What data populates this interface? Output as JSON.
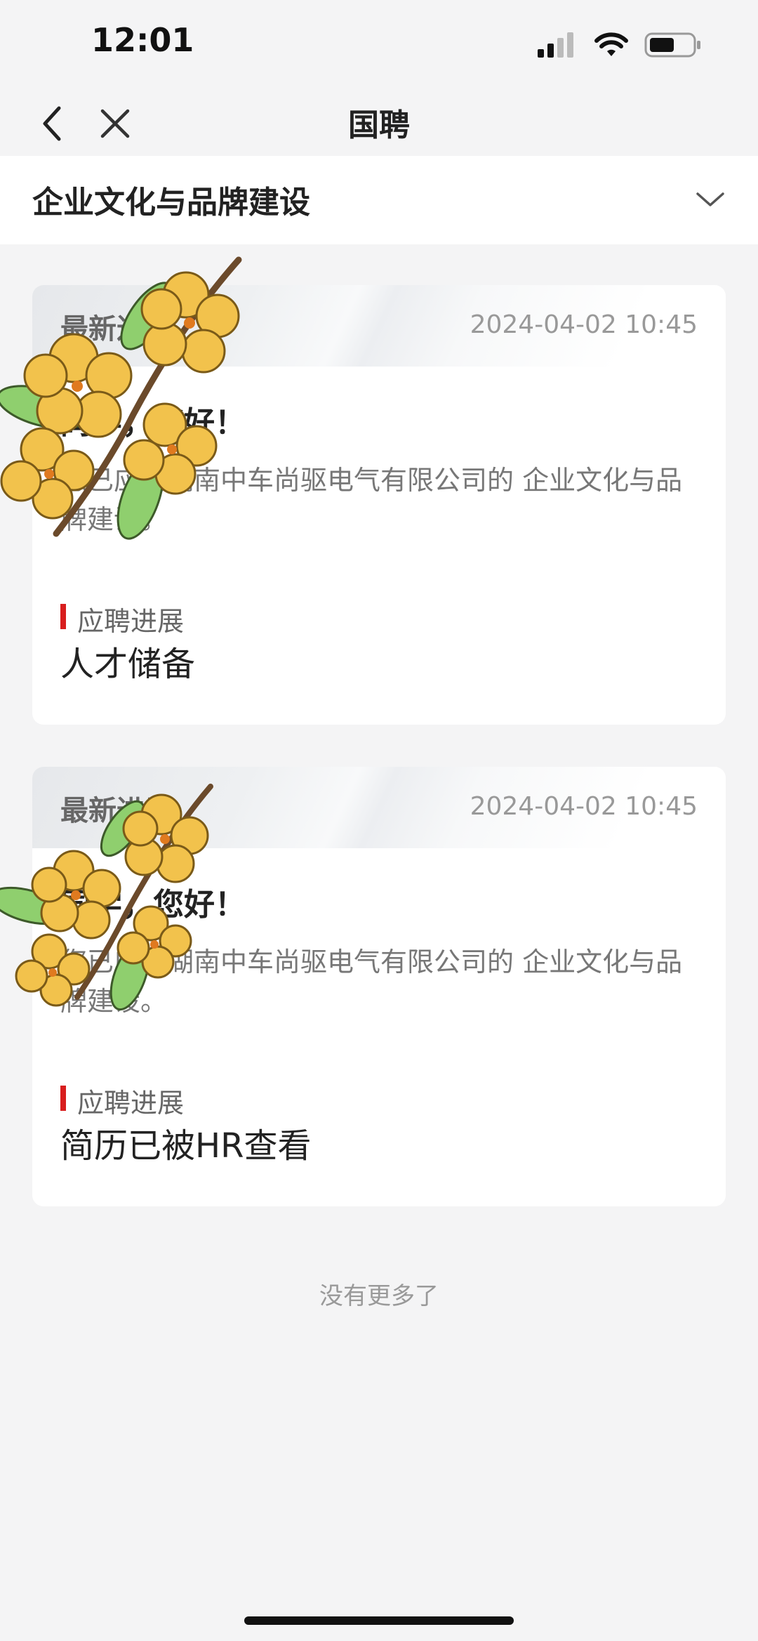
{
  "status_bar": {
    "time": "12:01"
  },
  "nav": {
    "title": "国聘"
  },
  "filter": {
    "label": "企业文化与品牌建设"
  },
  "cards": [
    {
      "head_title": "最新进展",
      "time": "2024-04-02 10:45",
      "greeting": "同学，您好！",
      "body": "您已应聘湖南中车尚驱电气有限公司的 企业文化与品牌建设。",
      "progress_label": "应聘进展",
      "progress_value": "人才储备"
    },
    {
      "head_title": "最新进展",
      "time": "2024-04-02 10:45",
      "greeting": "同学，您好！",
      "body": "您已应聘湖南中车尚驱电气有限公司的 企业文化与品牌建设。",
      "progress_label": "应聘进展",
      "progress_value": "简历已被HR查看"
    }
  ],
  "footer": {
    "note": "没有更多了"
  },
  "colors": {
    "accent": "#d81e1e",
    "flower_petal": "#f2c24c",
    "leaf": "#8fcf6e"
  }
}
